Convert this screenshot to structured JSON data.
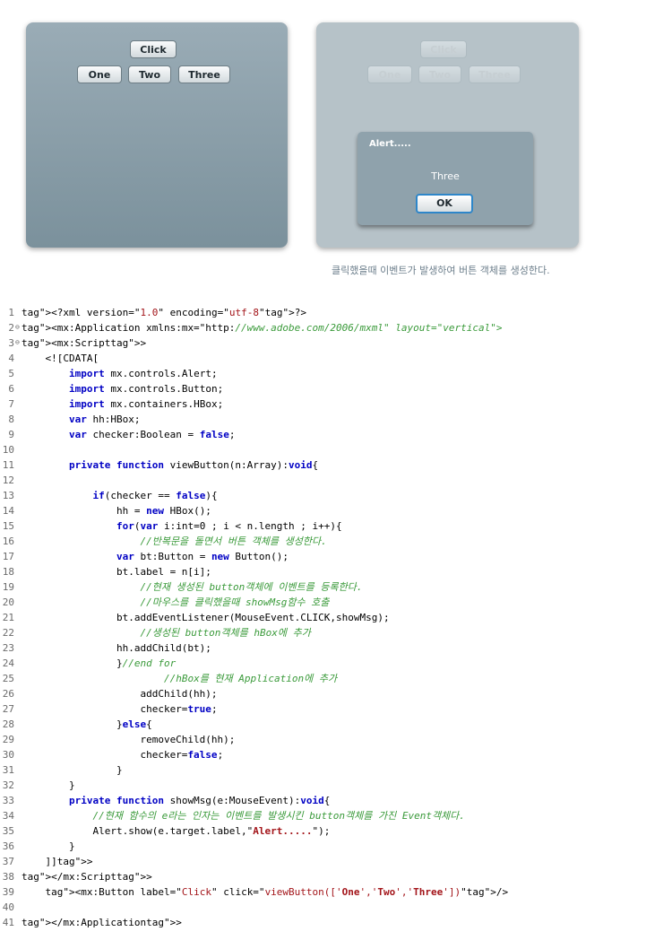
{
  "demo_before": {
    "click_label": "Click",
    "buttons": [
      "One",
      "Two",
      "Three"
    ]
  },
  "demo_after": {
    "click_label": "Click",
    "buttons": [
      "One",
      "Two",
      "Three"
    ],
    "alert": {
      "title": "Alert.....",
      "message": "Three",
      "ok_label": "OK"
    }
  },
  "caption": "클릭했을때 이벤트가 발생하여 버튼 객체를 생성한다.",
  "code_lines": [
    {
      "n": "1",
      "t": "<?xml version=\"1.0\" encoding=\"utf-8\"?>"
    },
    {
      "n": "2",
      "t": "<mx:Application xmlns:mx=\"http://www.adobe.com/2006/mxml\" layout=\"vertical\">"
    },
    {
      "n": "3",
      "t": "<mx:Script>"
    },
    {
      "n": "4",
      "t": "    <![CDATA["
    },
    {
      "n": "5",
      "t": "        import mx.controls.Alert;"
    },
    {
      "n": "6",
      "t": "        import mx.controls.Button;"
    },
    {
      "n": "7",
      "t": "        import mx.containers.HBox;"
    },
    {
      "n": "8",
      "t": "        var hh:HBox;"
    },
    {
      "n": "9",
      "t": "        var checker:Boolean = false;"
    },
    {
      "n": "10",
      "t": ""
    },
    {
      "n": "11",
      "t": "        private function viewButton(n:Array):void{"
    },
    {
      "n": "12",
      "t": ""
    },
    {
      "n": "13",
      "t": "            if(checker == false){"
    },
    {
      "n": "14",
      "t": "                hh = new HBox();"
    },
    {
      "n": "15",
      "t": "                for(var i:int=0 ; i < n.length ; i++){"
    },
    {
      "n": "16",
      "t": "                    //반복문을 돌면서 버튼 객체를 생성한다."
    },
    {
      "n": "17",
      "t": "                var bt:Button = new Button();"
    },
    {
      "n": "18",
      "t": "                bt.label = n[i];"
    },
    {
      "n": "19",
      "t": "                    //현재 생성된 button객체에 이벤트를 등록한다."
    },
    {
      "n": "20",
      "t": "                    //마우스를 클릭했을때 showMsg함수 호출"
    },
    {
      "n": "21",
      "t": "                bt.addEventListener(MouseEvent.CLICK,showMsg);"
    },
    {
      "n": "22",
      "t": "                    //생성된 button객체를 hBox에 추가"
    },
    {
      "n": "23",
      "t": "                hh.addChild(bt);"
    },
    {
      "n": "24",
      "t": "                }//end for"
    },
    {
      "n": "25",
      "t": "                        //hBox를 현재 Application에 추가"
    },
    {
      "n": "26",
      "t": "                    addChild(hh);"
    },
    {
      "n": "27",
      "t": "                    checker=true;"
    },
    {
      "n": "28",
      "t": "                }else{"
    },
    {
      "n": "29",
      "t": "                    removeChild(hh);"
    },
    {
      "n": "30",
      "t": "                    checker=false;"
    },
    {
      "n": "31",
      "t": "                }"
    },
    {
      "n": "32",
      "t": "        }"
    },
    {
      "n": "33",
      "t": "        private function showMsg(e:MouseEvent):void{"
    },
    {
      "n": "34",
      "t": "            //현재 함수의 e라는 인자는 이벤트를 발생시킨 button객체를 가진 Event객체다."
    },
    {
      "n": "35",
      "t": "            Alert.show(e.target.label,\"Alert.....\");"
    },
    {
      "n": "36",
      "t": "        }"
    },
    {
      "n": "37",
      "t": "    ]]>"
    },
    {
      "n": "38",
      "t": "</mx:Script>"
    },
    {
      "n": "39",
      "t": "    <mx:Button label=\"Click\" click=\"viewButton(['One','Two','Three'])\"/>"
    },
    {
      "n": "40",
      "t": ""
    },
    {
      "n": "41",
      "t": "</mx:Application>"
    }
  ]
}
